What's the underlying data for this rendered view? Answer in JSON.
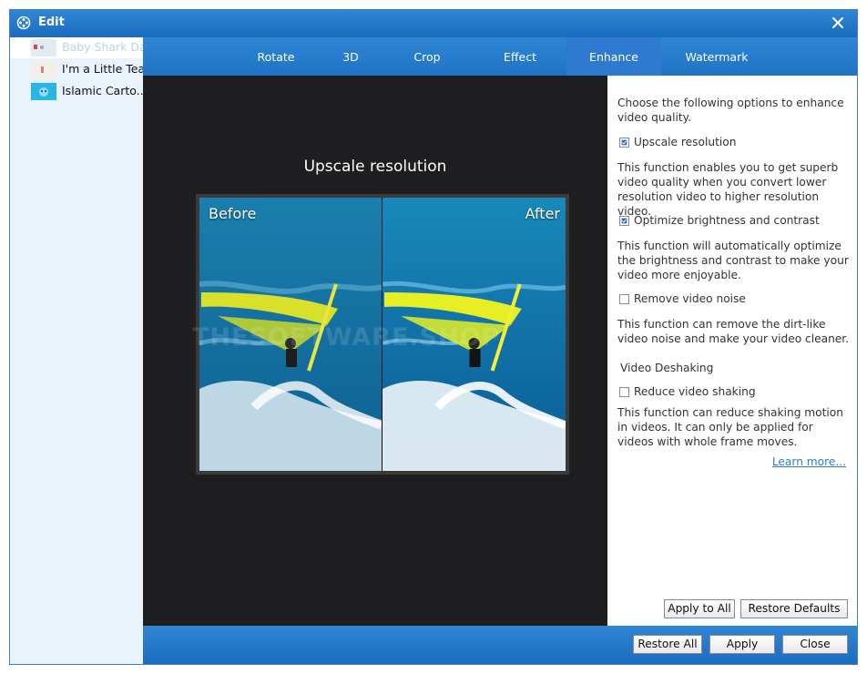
{
  "window": {
    "title": "Edit"
  },
  "files": [
    {
      "name": "Baby Shark Da..."
    },
    {
      "name": "I'm a Little Tea..."
    },
    {
      "name": "Islamic Carto..."
    }
  ],
  "tabs": [
    "Rotate",
    "3D",
    "Crop",
    "Effect",
    "Enhance",
    "Watermark"
  ],
  "active_tab": "Enhance",
  "preview": {
    "title": "Upscale resolution",
    "before_label": "Before",
    "after_label": "After",
    "watermark": "THESOFTWARE.SHOP"
  },
  "options": {
    "intro": "Choose the following options to enhance video quality.",
    "upscale": {
      "label": "Upscale resolution",
      "checked": true,
      "desc": "This function enables you to get superb video quality when you convert lower resolution video to higher resolution video."
    },
    "brightness": {
      "label": "Optimize brightness and contrast",
      "checked": true,
      "desc": "This function will automatically optimize the brightness and contrast to make your video more enjoyable."
    },
    "noise": {
      "label": "Remove video noise",
      "checked": false,
      "desc": "This function can remove the dirt-like video noise and make your video cleaner."
    },
    "deshaking_heading": "Video Deshaking",
    "shaking": {
      "label": "Reduce video shaking",
      "checked": false,
      "desc": "This function can reduce shaking motion in videos. It can only be applied for videos with whole frame moves."
    },
    "learn_more": "Learn more..."
  },
  "buttons": {
    "apply_to_all": "Apply to All",
    "restore_defaults": "Restore Defaults",
    "restore_all": "Restore All",
    "apply": "Apply",
    "close": "Close"
  },
  "colors": {
    "accent": "#1f73c6",
    "checkbox_check": "#2b6cc4",
    "link": "#2d7bd0"
  }
}
